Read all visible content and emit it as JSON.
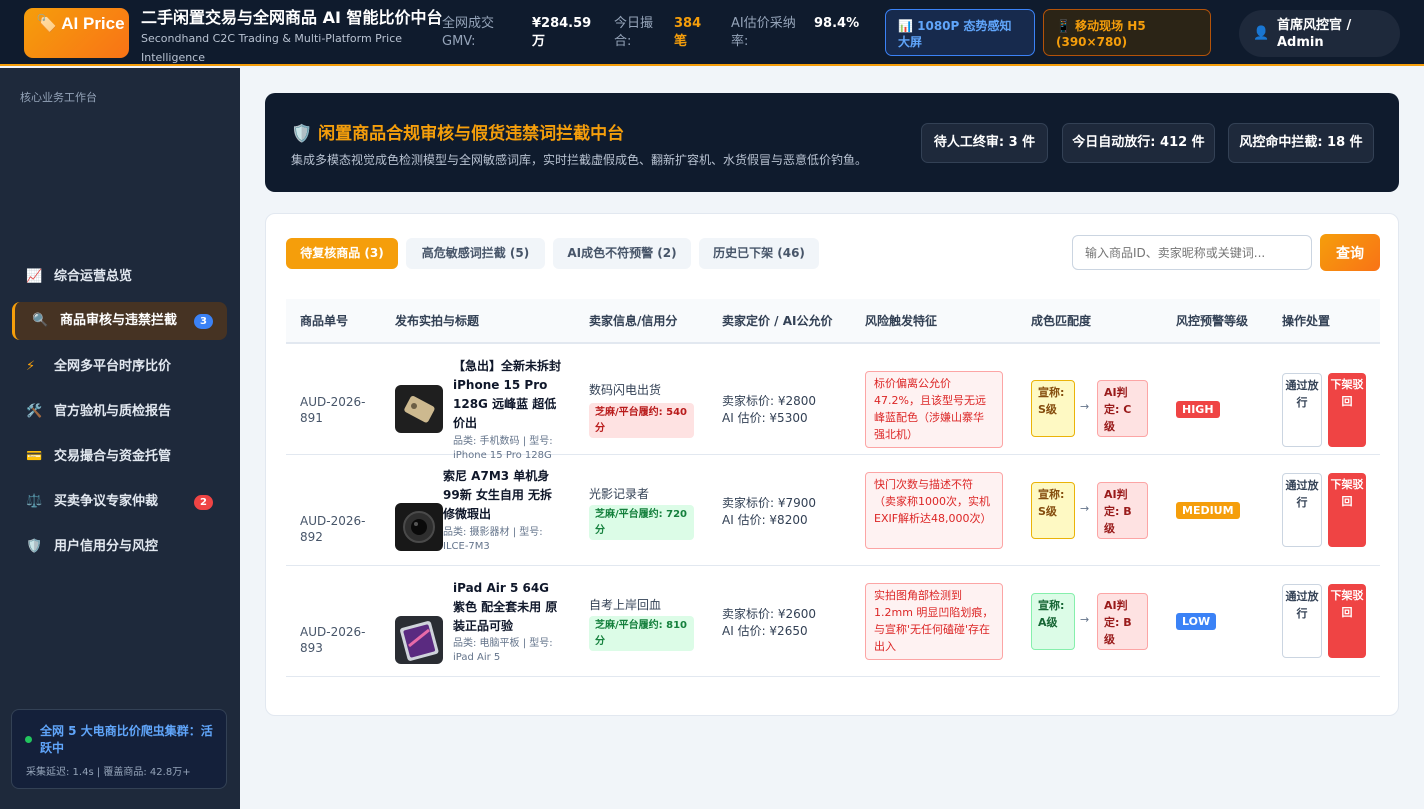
{
  "header": {
    "logo_text": "🏷️ AI Price",
    "title": "二手闲置交易与全网商品 AI 智能比价中台",
    "subtitle": "Secondhand C2C Trading & Multi-Platform Price Intelligence",
    "stats": [
      {
        "label": "全网成交GMV:",
        "value": "¥284.59万"
      },
      {
        "label": "今日撮合:",
        "value": "384笔"
      },
      {
        "label": "AI估价采纳率:",
        "value": "98.4%"
      }
    ],
    "btn_screen": "📊 1080P 态势感知大屏",
    "btn_mobile": "📱 移动现场 H5 (390×780)",
    "user_label": "首席风控官 / Admin"
  },
  "sidebar": {
    "caption": "核心业务工作台",
    "items": [
      {
        "icon": "📈",
        "label": "综合运营总览"
      },
      {
        "icon": "🔍",
        "label": "商品审核与违禁拦截",
        "badge": "3"
      },
      {
        "icon": "⚡",
        "label": "全网多平台时序比价"
      },
      {
        "icon": "🛠️",
        "label": "官方验机与质检报告"
      },
      {
        "icon": "💳",
        "label": "交易撮合与资金托管"
      },
      {
        "icon": "⚖️",
        "label": "买卖争议专家仲裁",
        "badge": "2"
      },
      {
        "icon": "🛡️",
        "label": "用户信用分与风控"
      }
    ],
    "crawler_title": "全网 5 大电商比价爬虫集群：活跃中",
    "crawler_meta": "采集延迟: 1.4s | 覆盖商品: 42.8万+"
  },
  "hero": {
    "title": "闲置商品合规审核与假货违禁词拦截中台",
    "desc": "集成多模态视觉成色检测模型与全网敏感词库，实时拦截虚假成色、翻新扩容机、水货假冒与恶意低价钓鱼。",
    "chips": [
      "待人工终审: 3 件",
      "今日自动放行: 412 件",
      "风控命中拦截: 18 件"
    ]
  },
  "tabs": [
    "待复核商品 (3)",
    "高危敏感词拦截 (5)",
    "AI成色不符预警 (2)",
    "历史已下架 (46)"
  ],
  "search": {
    "placeholder": "输入商品ID、卖家昵称或关键词...",
    "button": "查询"
  },
  "table": {
    "headers": [
      "商品单号",
      "发布实拍与标题",
      "卖家信息/信用分",
      "卖家定价 / AI公允价",
      "风险触发特征",
      "成色匹配度",
      "风控预警等级",
      "操作处置"
    ],
    "rows": [
      {
        "id": "AUD-2026-891",
        "title": "【急出】全新未拆封 iPhone 15 Pro 128G 远峰蓝 超低价出",
        "meta": "品类: 手机数码 | 型号: iPhone 15 Pro 128G",
        "seller": "数码闪电出货",
        "credit": "芝麻/平台履约: 540分",
        "price_seller": "卖家标价: ¥2800",
        "price_ai": "AI 估价: ¥5300",
        "risk": "标价偏离公允价 47.2%，且该型号无远峰蓝配色（涉嫌山寨华强北机）",
        "claim": "宣称: S级",
        "ai_grade": "AI判定: C级",
        "level": "HIGH",
        "pass": "通过放行",
        "off": "下架驳回"
      },
      {
        "id": "AUD-2026-892",
        "title": "索尼 A7M3 单机身 99新 女生自用 无拆修微瑕出",
        "meta": "品类: 摄影器材 | 型号: ILCE-7M3",
        "seller": "光影记录者",
        "credit": "芝麻/平台履约: 720分",
        "price_seller": "卖家标价: ¥7900",
        "price_ai": "AI 估价: ¥8200",
        "risk": "快门次数与描述不符（卖家称1000次，实机EXIF解析达48,000次）",
        "claim": "宣称: S级",
        "ai_grade": "AI判定: B级",
        "level": "MEDIUM",
        "pass": "通过放行",
        "off": "下架驳回"
      },
      {
        "id": "AUD-2026-893",
        "title": "iPad Air 5 64G 紫色 配全套未用 原装正品可验",
        "meta": "品类: 电脑平板 | 型号: iPad Air 5",
        "seller": "自考上岸回血",
        "credit": "芝麻/平台履约: 810分",
        "price_seller": "卖家标价: ¥2600",
        "price_ai": "AI 估价: ¥2650",
        "risk": "实拍图角部检测到 1.2mm 明显凹陷划痕，与宣称'无任何磕碰'存在出入",
        "claim": "宣称: A级",
        "ai_grade": "AI判定: B级",
        "level": "LOW",
        "pass": "通过放行",
        "off": "下架驳回"
      }
    ]
  },
  "colors": {
    "accent": "#f59e0b",
    "nav_bg": "#1e293b",
    "header_bg": "#0f1b2d",
    "high": "#ef4444",
    "medium": "#f59e0b",
    "low": "#3b82f6"
  }
}
